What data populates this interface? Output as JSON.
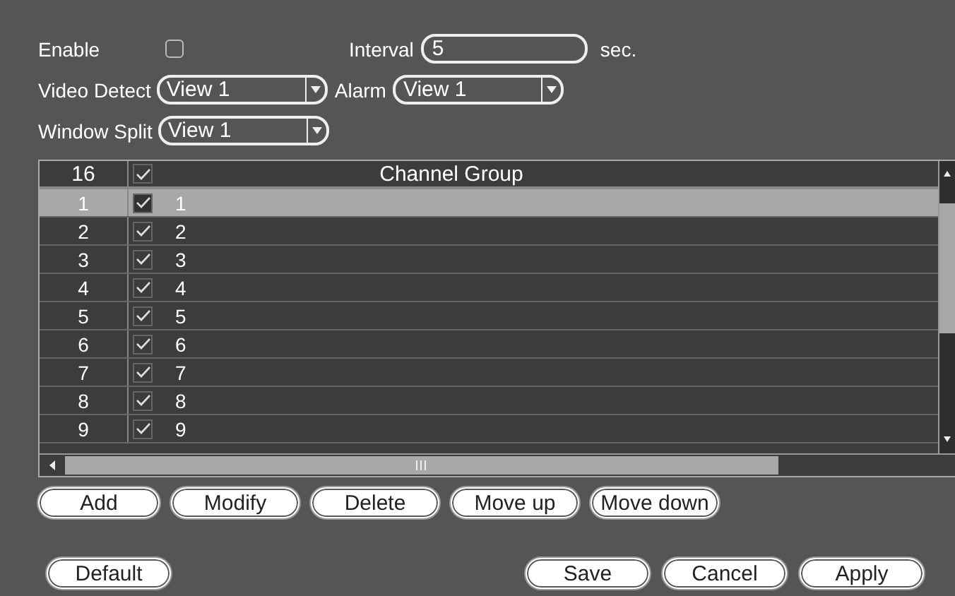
{
  "enable": {
    "label": "Enable",
    "checked": false
  },
  "interval": {
    "label": "Interval",
    "value": "5",
    "unit": "sec."
  },
  "video_detect": {
    "label": "Video Detect",
    "value": "View 1"
  },
  "alarm": {
    "label": "Alarm",
    "value": "View 1"
  },
  "window_split": {
    "label": "Window Split",
    "value": "View 1"
  },
  "table": {
    "columns": [
      "16",
      "Channel Group"
    ],
    "header_checked": true,
    "rows": [
      {
        "index": "1",
        "checked": true,
        "channel": "1",
        "selected": true
      },
      {
        "index": "2",
        "checked": true,
        "channel": "2",
        "selected": false
      },
      {
        "index": "3",
        "checked": true,
        "channel": "3",
        "selected": false
      },
      {
        "index": "4",
        "checked": true,
        "channel": "4",
        "selected": false
      },
      {
        "index": "5",
        "checked": true,
        "channel": "5",
        "selected": false
      },
      {
        "index": "6",
        "checked": true,
        "channel": "6",
        "selected": false
      },
      {
        "index": "7",
        "checked": true,
        "channel": "7",
        "selected": false
      },
      {
        "index": "8",
        "checked": true,
        "channel": "8",
        "selected": false
      },
      {
        "index": "9",
        "checked": true,
        "channel": "9",
        "selected": false
      }
    ]
  },
  "list_buttons": [
    "Add",
    "Modify",
    "Delete",
    "Move up",
    "Move down"
  ],
  "footer_left": [
    "Default"
  ],
  "footer_right": [
    "Save",
    "Cancel",
    "Apply"
  ]
}
